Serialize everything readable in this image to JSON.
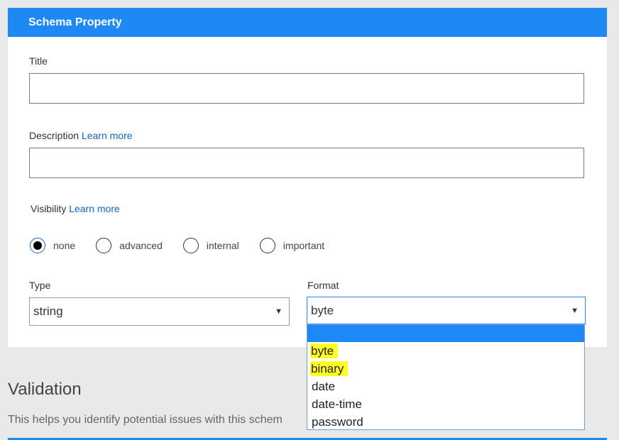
{
  "panel": {
    "header_title": "Schema Property"
  },
  "form": {
    "title_label": "Title",
    "title_value": "",
    "description_label": "Description",
    "description_link": "Learn more",
    "description_value": "",
    "visibility_label": "Visibility",
    "visibility_link": "Learn more",
    "visibility_options": [
      {
        "label": "none",
        "checked": true
      },
      {
        "label": "advanced",
        "checked": false
      },
      {
        "label": "internal",
        "checked": false
      },
      {
        "label": "important",
        "checked": false
      }
    ],
    "type_label": "Type",
    "type_value": "string",
    "format_label": "Format",
    "format_value": "byte"
  },
  "format_dropdown": {
    "options": [
      "",
      "byte",
      "binary",
      "date",
      "date-time",
      "password"
    ],
    "highlighted": [
      "byte",
      "binary"
    ],
    "highlight_color": "#ffff26"
  },
  "validation": {
    "title": "Validation",
    "description": "This helps you identify potential issues with this schem"
  },
  "colors": {
    "accent": "#1e88f5",
    "link": "#1565c0"
  }
}
